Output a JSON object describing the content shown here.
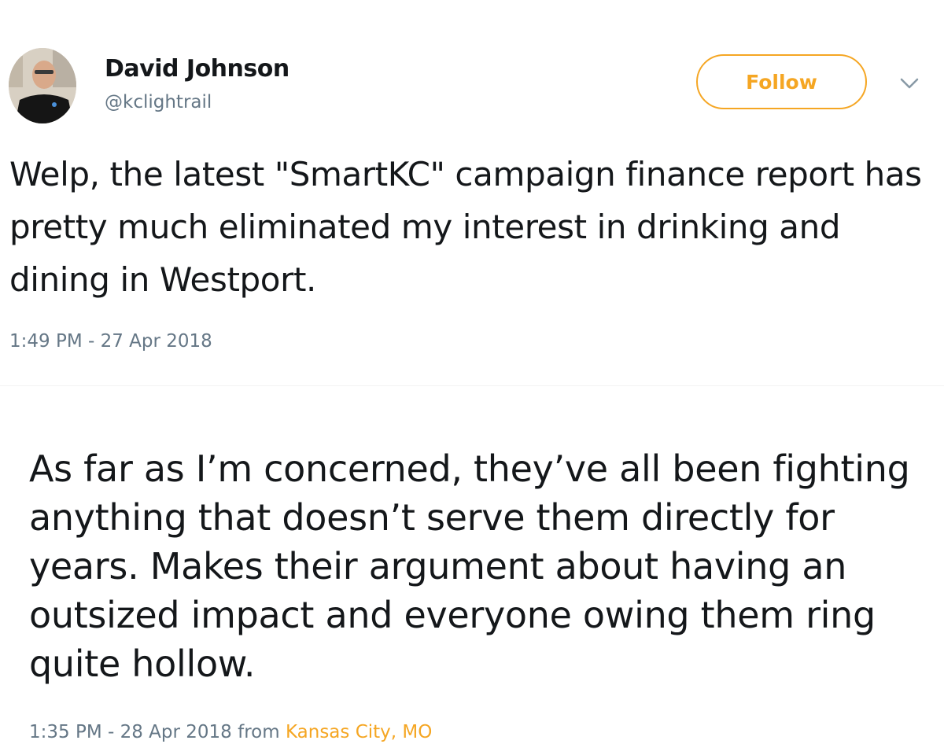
{
  "tweet1": {
    "author": {
      "display_name": "David Johnson",
      "handle": "@kclightrail"
    },
    "follow_label": "Follow",
    "text": "Welp, the latest \"SmartKC\" campaign finance report has pretty much eliminated my interest in drinking and dining in Westport.",
    "timestamp": "1:49 PM - 27 Apr 2018"
  },
  "tweet2": {
    "text": "As far as I’m concerned, they’ve all been fighting anything that doesn’t serve them directly for years. Makes their argument about having an outsized impact and everyone owing them ring quite hollow.",
    "timestamp": "1:35 PM - 28 Apr 2018",
    "from_label": " from ",
    "location": "Kansas City, MO"
  },
  "icons": {
    "avatar": "avatar-photo",
    "caret": "chevron-down-icon"
  },
  "colors": {
    "accent": "#f5a623",
    "text_primary": "#14171a",
    "text_secondary": "#657786"
  }
}
